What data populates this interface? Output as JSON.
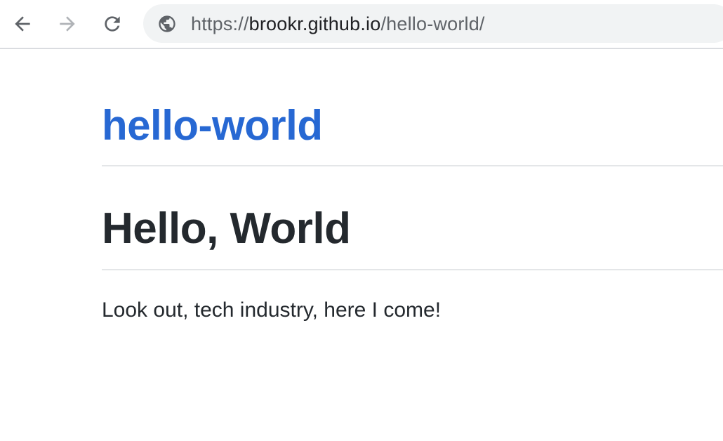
{
  "browser": {
    "back_icon": "arrow-left-icon",
    "forward_icon": "arrow-right-icon",
    "reload_icon": "reload-icon",
    "site_info_icon": "globe-icon",
    "url_scheme": "https://",
    "url_host": "brookr.github.io",
    "url_path": "/hello-world/"
  },
  "page": {
    "site_title": "hello-world",
    "post_title": "Hello, World",
    "post_body": "Look out, tech industry, here I come!"
  },
  "colors": {
    "link": "#2768d3",
    "text": "#24292e",
    "omnibox_bg": "#f1f3f4",
    "rule": "#e4e6e8"
  }
}
